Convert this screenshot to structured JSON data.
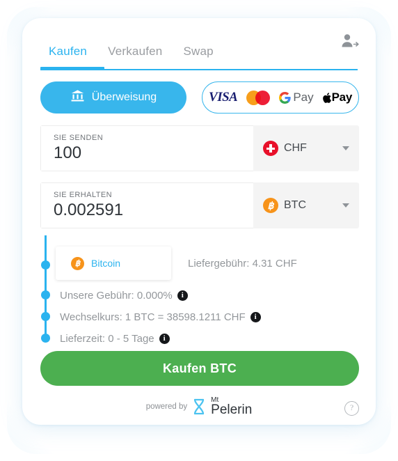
{
  "header": {
    "login_icon": "user-login-icon"
  },
  "tabs": [
    {
      "label": "Kaufen",
      "active": true
    },
    {
      "label": "Verkaufen",
      "active": false
    },
    {
      "label": "Swap",
      "active": false
    }
  ],
  "payment_methods": {
    "bank": {
      "label": "Überweisung",
      "icon": "bank-icon"
    },
    "cards": {
      "visa": "VISA",
      "mastercard": "mastercard-icon",
      "gpay": "Pay",
      "applepay": "Pay"
    }
  },
  "send_field": {
    "label": "SIE SENDEN",
    "value": "100",
    "currency": "CHF",
    "currency_icon": "swiss-flag-icon"
  },
  "receive_field": {
    "label": "SIE ERHALTEN",
    "value": "0.002591",
    "currency": "BTC",
    "currency_icon": "bitcoin-icon"
  },
  "details": {
    "asset": {
      "name": "Bitcoin",
      "icon": "bitcoin-icon"
    },
    "delivery_fee": "Liefergebühr: 4.31 CHF",
    "our_fee": "Unsere Gebühr: 0.000%",
    "exchange_rate": "Wechselkurs: 1 BTC = 38598.1211 CHF",
    "delivery_time": "Lieferzeit: 0 - 5 Tage",
    "info_glyph": "i"
  },
  "buy_button": {
    "label": "Kaufen BTC"
  },
  "footer": {
    "powered_by": "powered by",
    "brand_top": "Mt",
    "brand_bottom": "Pelerin",
    "help_glyph": "?"
  },
  "colors": {
    "accent": "#2bb3ef",
    "bank_button": "#38b6ec",
    "buy_button": "#4caf50",
    "bitcoin": "#f7931a",
    "chf_red": "#e8102a",
    "muted_text": "#93979b"
  }
}
